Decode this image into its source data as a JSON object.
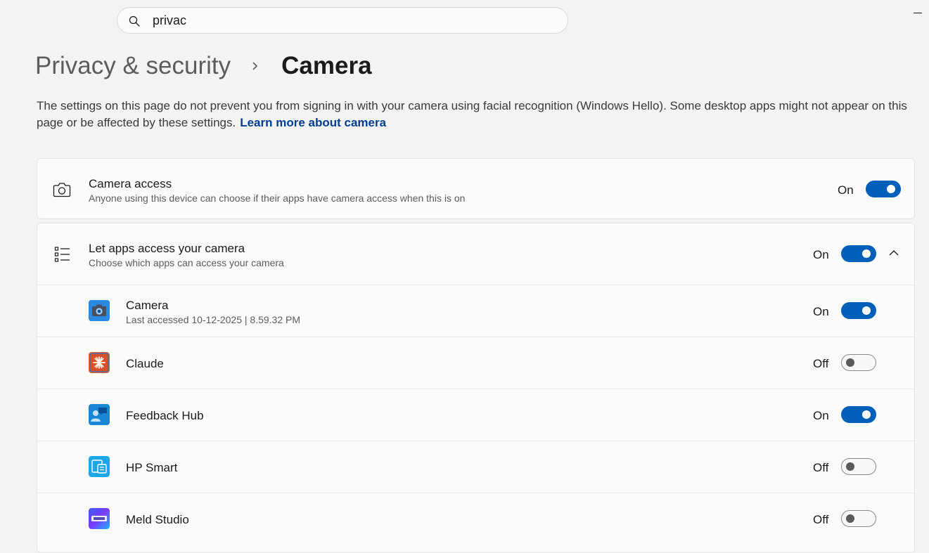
{
  "search": {
    "value": "privac",
    "placeholder": ""
  },
  "breadcrumb": {
    "parent": "Privacy & security",
    "current": "Camera"
  },
  "description": {
    "text": "The settings on this page do not prevent you from signing in with your camera using facial recognition (Windows Hello). Some desktop apps might not appear on this page or be affected by these settings.",
    "link": "Learn more about camera"
  },
  "camera_access": {
    "title": "Camera access",
    "subtitle": "Anyone using this device can choose if their apps have camera access when this is on",
    "state": "On",
    "icon": "camera-icon"
  },
  "let_apps": {
    "title": "Let apps access your camera",
    "subtitle": "Choose which apps can access your camera",
    "state": "On",
    "icon": "list-icon"
  },
  "apps": [
    {
      "name": "Camera",
      "subtitle": "Last accessed 10-12-2025  |  8.59.32 PM",
      "state": "On",
      "icon": "camera-app-icon"
    },
    {
      "name": "Claude",
      "subtitle": "",
      "state": "Off",
      "icon": "claude-app-icon"
    },
    {
      "name": "Feedback Hub",
      "subtitle": "",
      "state": "On",
      "icon": "feedback-hub-app-icon"
    },
    {
      "name": "HP Smart",
      "subtitle": "",
      "state": "Off",
      "icon": "hp-smart-app-icon"
    },
    {
      "name": "Meld Studio",
      "subtitle": "",
      "state": "Off",
      "icon": "meld-studio-app-icon"
    }
  ],
  "colors": {
    "accent": "#005fb8",
    "link": "#003e92",
    "background": "#f3f3f3",
    "card": "#fbfbfb"
  }
}
